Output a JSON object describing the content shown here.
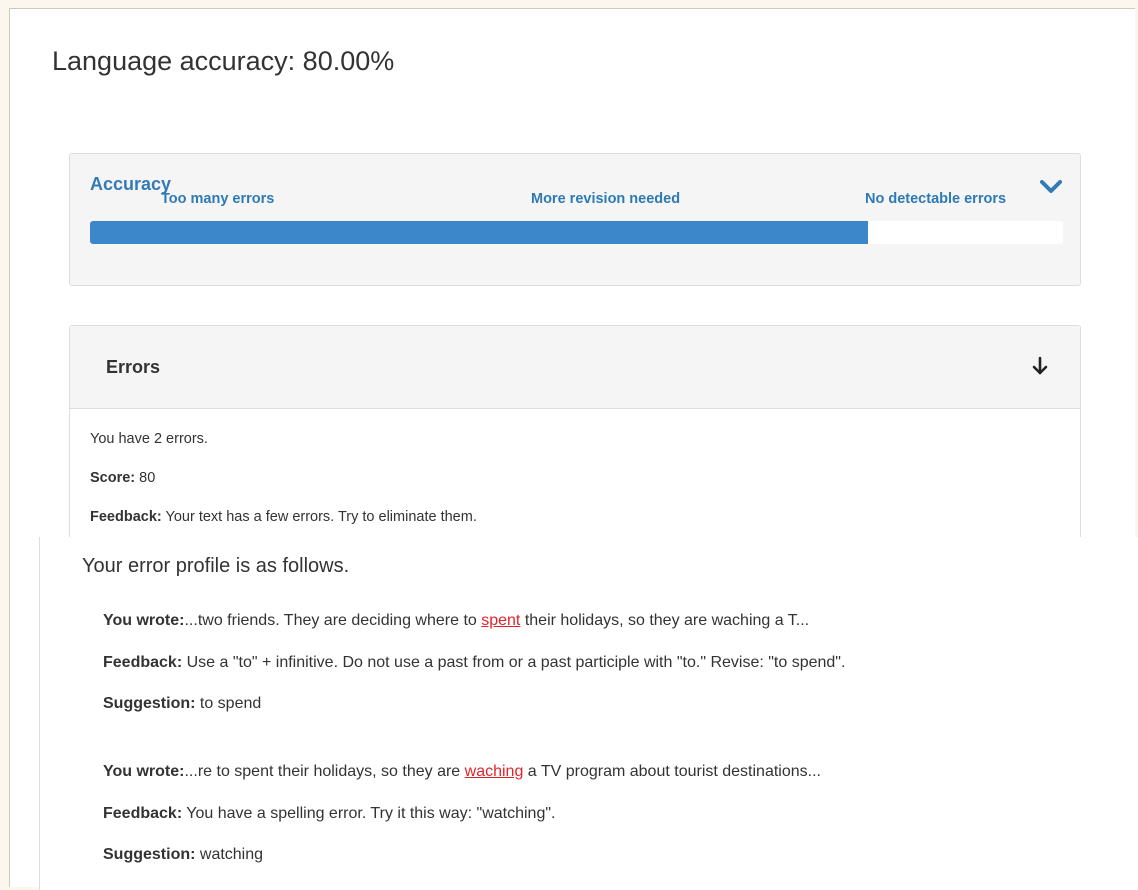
{
  "page": {
    "title": "Language accuracy: 80.00%"
  },
  "accuracy": {
    "heading": "Accuracy",
    "scale_labels": [
      "Too many errors",
      "More revision needed",
      "No detectable errors"
    ],
    "progress_fraction": 0.8,
    "bar_color": "#3b87c9",
    "chevron_icon": "chevron-down-icon"
  },
  "errors_panel": {
    "heading": "Errors",
    "arrow_icon": "arrow-down-icon",
    "count_text": "You have 2 errors.",
    "score_label": "Score:",
    "score_value": " 80",
    "feedback_label": "Feedback:",
    "feedback_text": " Your text has a few errors. Try to eliminate them."
  },
  "profile": {
    "title": "Your error profile is as follows.",
    "entries": [
      {
        "wrote_label": "You wrote:",
        "before": "...two friends. They are deciding where to ",
        "error": "spent",
        "after": " their holidays, so they are waching a T...",
        "feedback_label": "Feedback:",
        "feedback": " Use a \"to\" + infinitive. Do not use a past from or a past participle with \"to.\" Revise: \"to spend\".",
        "suggestion_label": "Suggestion:",
        "suggestion": " to spend"
      },
      {
        "wrote_label": "You wrote:",
        "before": "...re to spent their holidays, so they are ",
        "error": "waching",
        "after": " a TV program about tourist destinations...",
        "feedback_label": "Feedback:",
        "feedback": " You have a spelling error. Try it this way: \"watching\".",
        "suggestion_label": "Suggestion:",
        "suggestion": " watching"
      }
    ]
  },
  "colors": {
    "accent": "#337ab7",
    "error": "#e0242b"
  }
}
